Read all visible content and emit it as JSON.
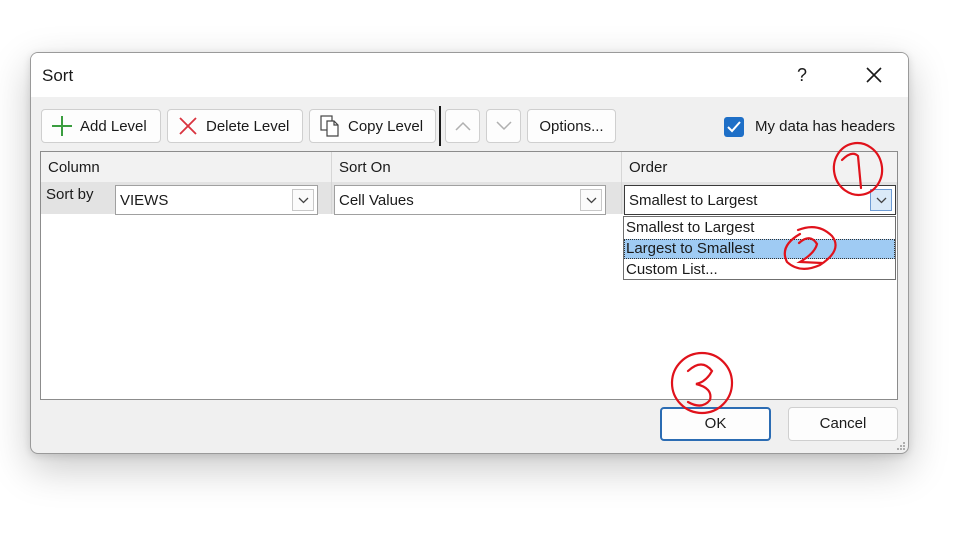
{
  "dialog": {
    "title": "Sort",
    "help_label": "?",
    "toolbar": {
      "add_level": "Add Level",
      "delete_level": "Delete Level",
      "copy_level": "Copy Level",
      "options": "Options..."
    },
    "headers_checkbox": {
      "label": "My data has headers",
      "checked": true
    },
    "columns": {
      "column": "Column",
      "sort_on": "Sort On",
      "order": "Order"
    },
    "level": {
      "prefix": "Sort by",
      "column_value": "VIEWS",
      "sort_on_value": "Cell Values",
      "order_value": "Smallest to Largest"
    },
    "order_options": [
      "Smallest to Largest",
      "Largest to Smallest",
      "Custom List..."
    ],
    "highlighted_option": "Largest to Smallest",
    "buttons": {
      "ok": "OK",
      "cancel": "Cancel"
    }
  },
  "annotations": [
    "1",
    "2",
    "3"
  ],
  "colors": {
    "accent": "#1e6fc7",
    "selection": "#9fcbf3",
    "annotation": "#e0121b"
  },
  "icons": [
    "close-icon",
    "add-icon",
    "delete-icon",
    "copy-icon",
    "move-up-icon",
    "move-down-icon",
    "chevron-down-icon",
    "checkmark-icon",
    "resize-grip-icon"
  ]
}
